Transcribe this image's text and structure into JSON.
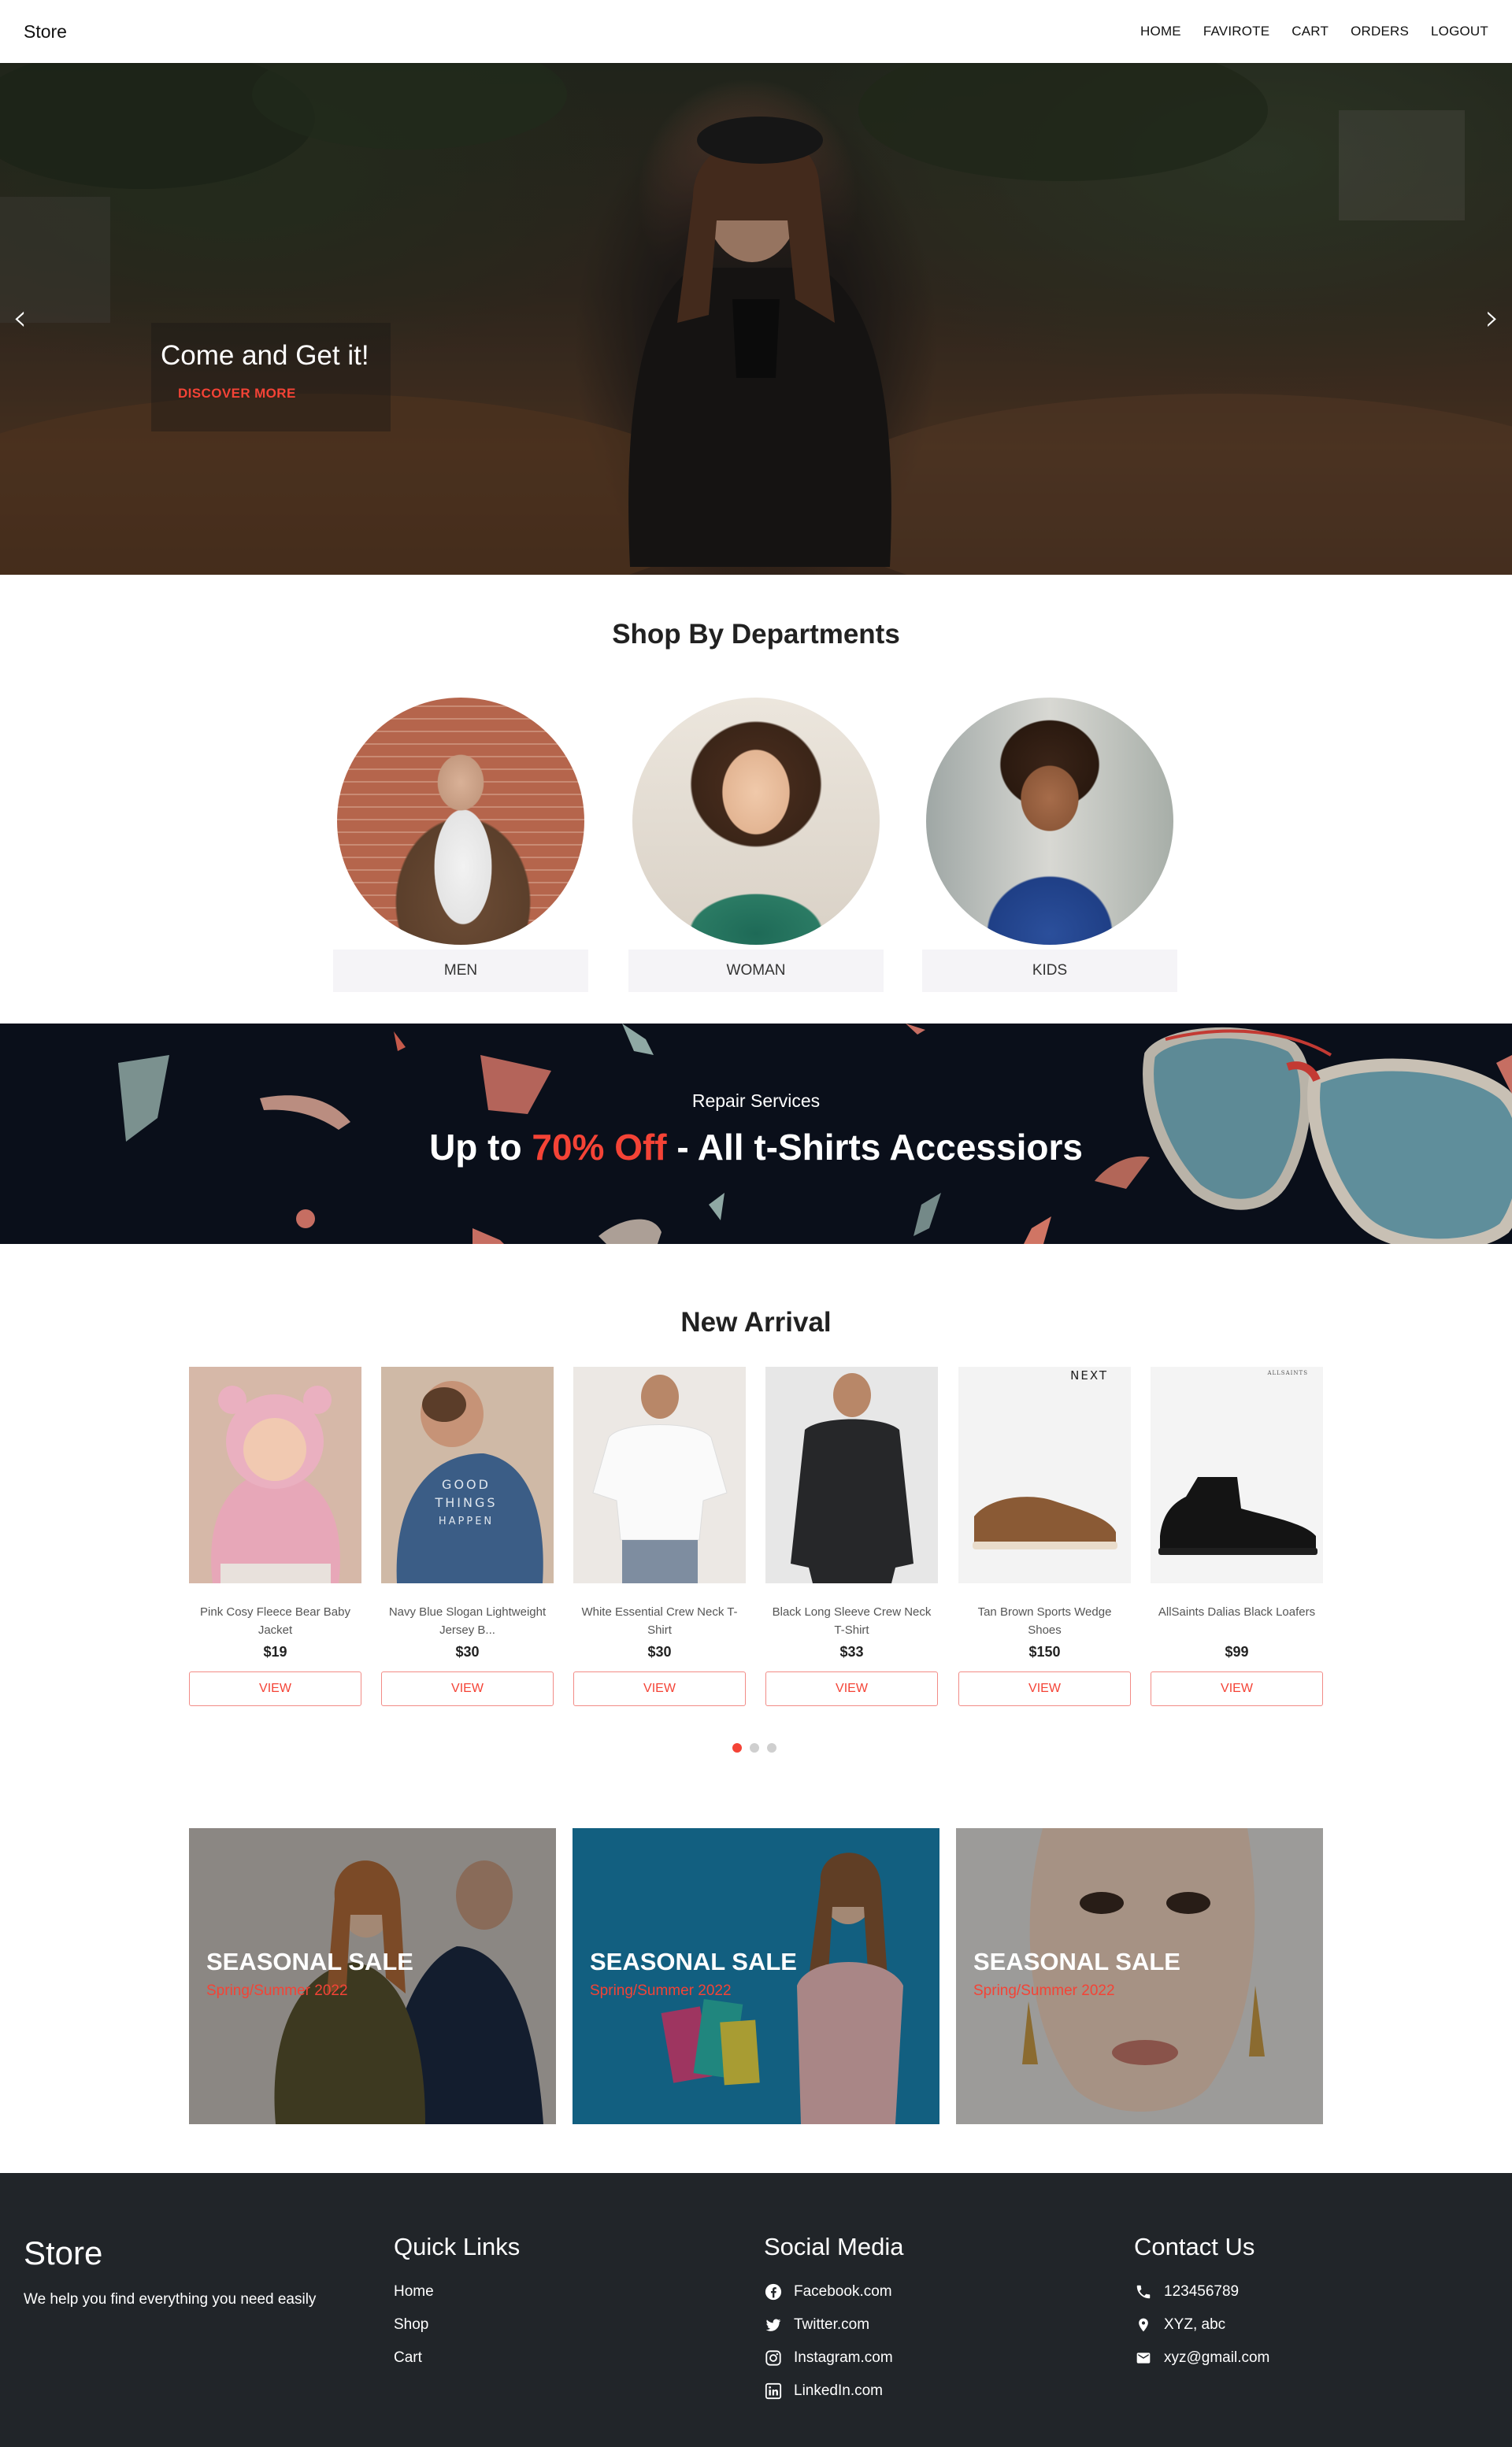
{
  "navbar": {
    "brand": "Store",
    "links": [
      "HOME",
      "FAVIROTE",
      "CART",
      "ORDERS",
      "LOGOUT"
    ]
  },
  "hero": {
    "title": "Come and Get it!",
    "cta": "DISCOVER MORE"
  },
  "departments": {
    "title": "Shop By Departments",
    "items": [
      "MEN",
      "WOMAN",
      "KIDS"
    ]
  },
  "promo": {
    "subtitle": "Repair Services",
    "title_prefix": "Up to ",
    "title_accent": "70% Off",
    "title_suffix": " - All t-Shirts Accessiors"
  },
  "new_arrival": {
    "title": "New Arrival",
    "view_label": "VIEW",
    "products": [
      {
        "name": "Pink Cosy Fleece Bear Baby Jacket",
        "price": "$19"
      },
      {
        "name": "Navy Blue Slogan Lightweight Jersey B...",
        "price": "$30"
      },
      {
        "name": "White Essential Crew Neck T-Shirt",
        "price": "$30"
      },
      {
        "name": "Black Long Sleeve Crew Neck T-Shirt",
        "price": "$33"
      },
      {
        "name": "Tan Brown Sports Wedge Shoes",
        "price": "$150"
      },
      {
        "name": "AllSaints Dalias Black Loafers",
        "price": "$99"
      }
    ],
    "image_text": {
      "hoodie_print": "GOOD THINGS HAPPEN",
      "brand_next": "NEXT",
      "brand_allsaints": "ALLSAINTS"
    },
    "carousel_pages": 3,
    "carousel_active": 1
  },
  "sales": [
    {
      "title": "SEASONAL SALE",
      "subtitle": "Spring/Summer 2022"
    },
    {
      "title": "SEASONAL SALE",
      "subtitle": "Spring/Summer 2022"
    },
    {
      "title": "SEASONAL SALE",
      "subtitle": "Spring/Summer 2022"
    }
  ],
  "footer": {
    "brand": "Store",
    "tagline": "We help you find everything you need easily",
    "quick_links": {
      "title": "Quick Links",
      "items": [
        "Home",
        "Shop",
        "Cart"
      ]
    },
    "social": {
      "title": "Social Media",
      "items": [
        {
          "label": "Facebook.com",
          "icon": "facebook-icon"
        },
        {
          "label": "Twitter.com",
          "icon": "twitter-icon"
        },
        {
          "label": "Instagram.com",
          "icon": "instagram-icon"
        },
        {
          "label": "LinkedIn.com",
          "icon": "linkedin-icon"
        }
      ]
    },
    "contact": {
      "title": "Contact Us",
      "items": [
        {
          "label": "123456789",
          "icon": "phone-icon"
        },
        {
          "label": "XYZ, abc",
          "icon": "location-pin-icon"
        },
        {
          "label": "xyz@gmail.com",
          "icon": "email-icon"
        }
      ]
    }
  },
  "colors": {
    "accent": "#f44336",
    "footer_bg": "#212529",
    "promo_bg": "#0a0f1a"
  }
}
